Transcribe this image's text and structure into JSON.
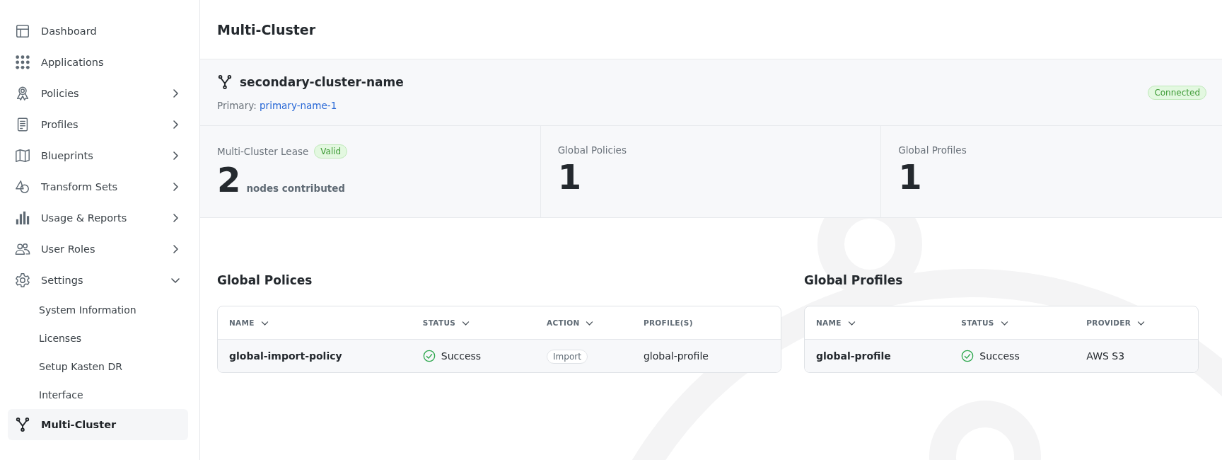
{
  "sidebar": {
    "items": [
      {
        "label": "Dashboard",
        "kind": "link",
        "selected": false
      },
      {
        "label": "Applications",
        "kind": "link",
        "selected": false
      },
      {
        "label": "Policies",
        "kind": "group",
        "expanded": false,
        "selected": false
      },
      {
        "label": "Profiles",
        "kind": "group",
        "expanded": false,
        "selected": false
      },
      {
        "label": "Blueprints",
        "kind": "group",
        "expanded": false,
        "selected": false
      },
      {
        "label": "Transform Sets",
        "kind": "group",
        "expanded": false,
        "selected": false
      },
      {
        "label": "Usage & Reports",
        "kind": "group",
        "expanded": false,
        "selected": false
      },
      {
        "label": "User Roles",
        "kind": "group",
        "expanded": false,
        "selected": false
      },
      {
        "label": "Settings",
        "kind": "group",
        "expanded": true,
        "selected": false,
        "children": [
          {
            "label": "System Information",
            "selected": false
          },
          {
            "label": "Licenses",
            "selected": false
          },
          {
            "label": "Setup Kasten DR",
            "selected": false
          },
          {
            "label": "Interface",
            "selected": false
          }
        ]
      },
      {
        "label": "Multi-Cluster",
        "kind": "link",
        "selected": true
      }
    ]
  },
  "page": {
    "title": "Multi-Cluster"
  },
  "cluster": {
    "name": "secondary-cluster-name",
    "primary_label": "Primary:",
    "primary_link": "primary-name-1",
    "status": "Connected"
  },
  "stats": [
    {
      "label": "Multi-Cluster Lease",
      "badge": "Valid",
      "value": "2",
      "unit": "nodes contributed"
    },
    {
      "label": "Global Policies",
      "value": "1"
    },
    {
      "label": "Global Profiles",
      "value": "1"
    }
  ],
  "tables": [
    {
      "title": "Global Polices",
      "columns": [
        {
          "label": "NAME",
          "sortable": true
        },
        {
          "label": "STATUS",
          "sortable": true
        },
        {
          "label": "ACTION",
          "sortable": true
        },
        {
          "label": "PROFILE(S)",
          "sortable": false
        }
      ],
      "rows": [
        [
          {
            "kind": "name",
            "text": "global-import-policy"
          },
          {
            "kind": "status",
            "text": "Success"
          },
          {
            "kind": "tag",
            "text": "Import"
          },
          {
            "kind": "text",
            "text": "global-profile"
          }
        ]
      ]
    },
    {
      "title": "Global Profiles",
      "columns": [
        {
          "label": "NAME",
          "sortable": true
        },
        {
          "label": "STATUS",
          "sortable": true
        },
        {
          "label": "PROVIDER",
          "sortable": true
        }
      ],
      "rows": [
        [
          {
            "kind": "name",
            "text": "global-profile"
          },
          {
            "kind": "status",
            "text": "Success"
          },
          {
            "kind": "text",
            "text": "AWS S3"
          }
        ]
      ]
    }
  ]
}
